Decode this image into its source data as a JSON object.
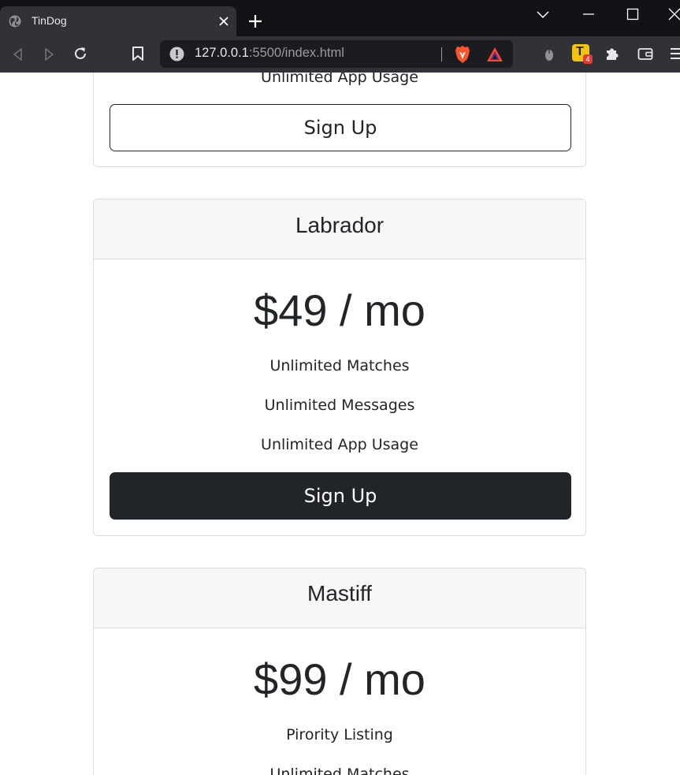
{
  "browser": {
    "tab_title": "TinDog",
    "url_host": "127.0.0.1",
    "url_rest": ":5500/index.html",
    "extension_badge_letter": "T",
    "extension_badge_count": "4"
  },
  "page": {
    "top_card": {
      "last_feature": "Unlimited App Usage",
      "button_label": "Sign Up"
    },
    "cards": [
      {
        "title": "Labrador",
        "price": "$49 / mo",
        "features": [
          "Unlimited Matches",
          "Unlimited Messages",
          "Unlimited App Usage"
        ],
        "button_label": "Sign Up"
      },
      {
        "title": "Mastiff",
        "price": "$99 / mo",
        "features": [
          "Pirority Listing",
          "Unlimited Matches"
        ]
      }
    ]
  },
  "colors": {
    "chrome_tabbar": "#121316",
    "chrome_toolbar": "#303238",
    "dark_button": "#212529",
    "card_header_bg": "#f7f7f7",
    "card_border": "#dcdcdc"
  }
}
